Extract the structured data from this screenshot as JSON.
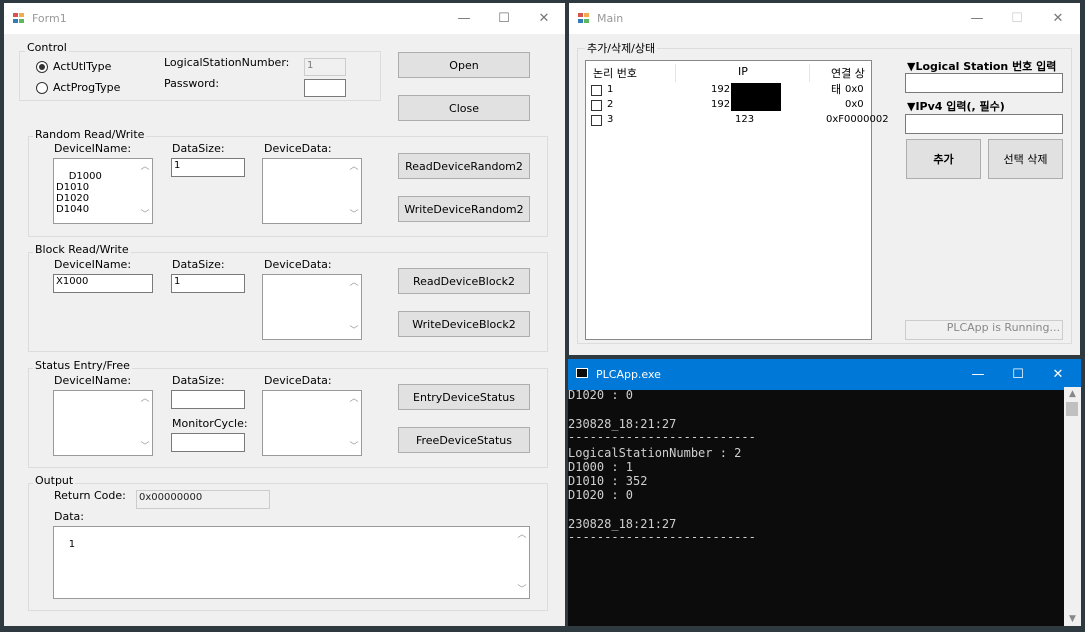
{
  "form1": {
    "title": "Form1",
    "control": {
      "label": "Control",
      "radio_util": "ActUtlType",
      "radio_prog": "ActProgType",
      "lsn_label": "LogicalStationNumber:",
      "lsn_value": "1",
      "password_label": "Password:",
      "password_value": "",
      "open_label": "Open",
      "close_label": "Close"
    },
    "random": {
      "label": "Random Read/Write",
      "device_name_label": "DeviceIName:",
      "device_name_value": "D1000\nD1010\nD1020\nD1040",
      "datasize_label": "DataSize:",
      "datasize_value": "1",
      "devicedata_label": "DeviceData:",
      "devicedata_value": "",
      "read_label": "ReadDeviceRandom2",
      "write_label": "WriteDeviceRandom2"
    },
    "block": {
      "label": "Block Read/Write",
      "device_name_label": "DeviceIName:",
      "device_name_value": "X1000",
      "datasize_label": "DataSize:",
      "datasize_value": "1",
      "devicedata_label": "DeviceData:",
      "devicedata_value": "",
      "read_label": "ReadDeviceBlock2",
      "write_label": "WriteDeviceBlock2"
    },
    "status": {
      "label": "Status Entry/Free",
      "device_name_label": "DeviceIName:",
      "datasize_label": "DataSize:",
      "devicedata_label": "DeviceData:",
      "monitor_label": "MonitorCycle:",
      "entry_label": "EntryDeviceStatus",
      "free_label": "FreeDeviceStatus"
    },
    "output": {
      "label": "Output",
      "return_code_label": "Return Code:",
      "return_code_value": "0x00000000",
      "data_label": "Data:",
      "data_value": "1"
    }
  },
  "main": {
    "title": "Main",
    "group_label": "추가/삭제/상태",
    "columns": [
      "논리 번호",
      "IP",
      "연결 상태"
    ],
    "rows": [
      {
        "num": "1",
        "ip": "192,",
        "status": "0x0"
      },
      {
        "num": "2",
        "ip": "192,",
        "status": "0x0"
      },
      {
        "num": "3",
        "ip": "123",
        "status": "0xF0000002"
      }
    ],
    "lsn_input_label": "▼Logical Station 번호 입력",
    "lsn_input_value": "",
    "ip_input_label": "▼IPv4 입력(, 필수)",
    "ip_input_value": "",
    "add_label": "추가",
    "delete_label": "선택 삭제",
    "status_text": "PLCApp is Running..."
  },
  "console": {
    "title": "PLCApp.exe",
    "lines": [
      "D1020 : 0",
      "",
      "230828_18:21:27",
      "--------------------------",
      "LogicalStationNumber : 2",
      "D1000 : 1",
      "D1010 : 352",
      "D1020 : 0",
      "",
      "230828_18:21:27",
      "--------------------------"
    ]
  },
  "caption": {
    "minimize": "—",
    "maximize": "☐",
    "close": "✕"
  },
  "colors": {
    "console_bg": "#0c0c0c",
    "console_titlebar": "#0078d7",
    "desktop": "#2f3a40"
  }
}
